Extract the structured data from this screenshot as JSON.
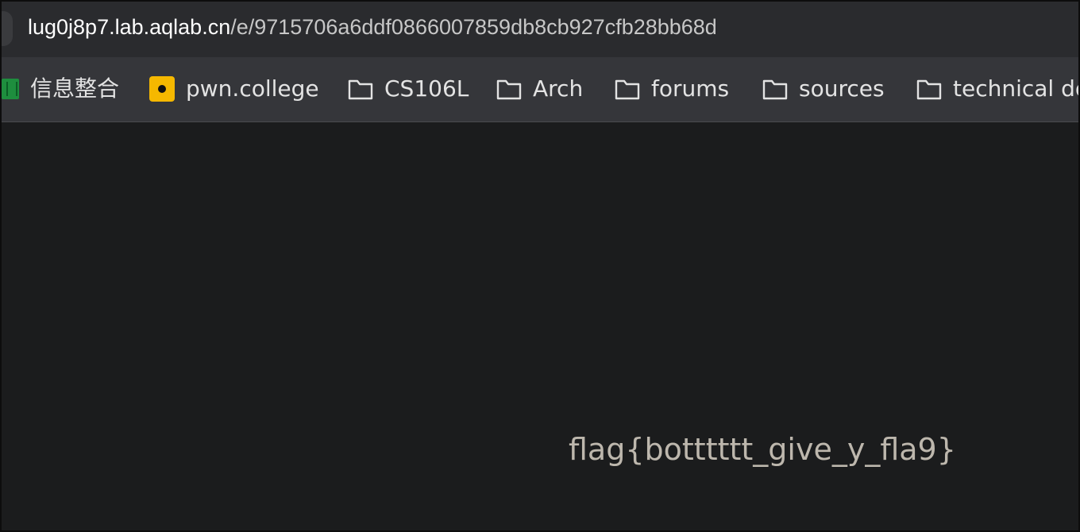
{
  "address_bar": {
    "url_host": "lug0j8p7.lab.aqlab.cn",
    "url_path": "/e/9715706a6ddf0866007859db8cb927cfb28bb68d"
  },
  "bookmarks": [
    {
      "label": "信息整合",
      "icon": "spreadsheet-icon"
    },
    {
      "label": "pwn.college",
      "icon": "pwn-college-icon"
    },
    {
      "label": "CS106L",
      "icon": "folder-icon"
    },
    {
      "label": "Arch",
      "icon": "folder-icon"
    },
    {
      "label": "forums",
      "icon": "folder-icon"
    },
    {
      "label": "sources",
      "icon": "folder-icon"
    },
    {
      "label": "technical do",
      "icon": "folder-icon"
    }
  ],
  "page": {
    "flag_text": "flag{botttttt_give_y_fla9}"
  },
  "colors": {
    "background": "#1b1c1d",
    "url_bar": "#2a2b2e",
    "bookmark_bar": "#35363a",
    "flag_text": "#bdb7ad",
    "pwn_icon": "#f5b800"
  }
}
